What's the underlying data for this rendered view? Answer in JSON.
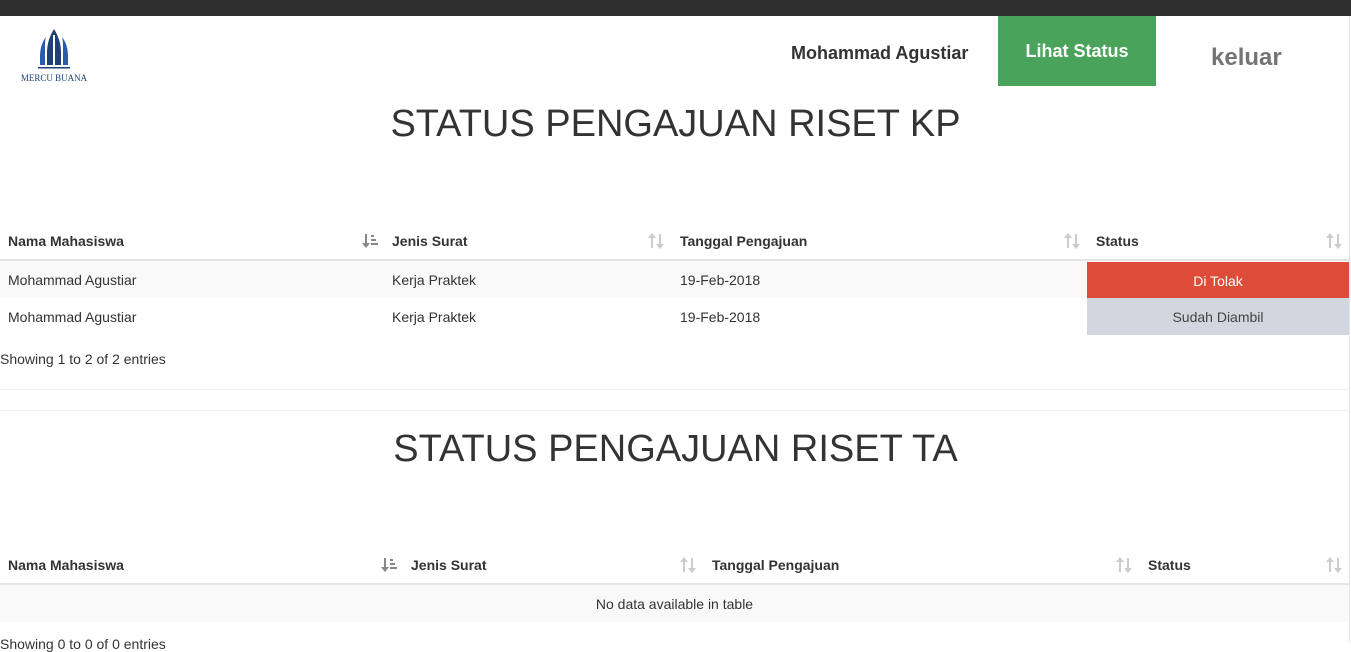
{
  "header": {
    "logo_text": "MERCU BUANA",
    "user_name": "Mohammad Agustiar",
    "status_button": "Lihat Status",
    "logout": "keluar",
    "accent_green": "#4aa35a"
  },
  "kp": {
    "title": "STATUS PENGAJUAN RISET KP",
    "columns": [
      "Nama Mahasiswa",
      "Jenis Surat",
      "Tanggal Pengajuan",
      "Status"
    ],
    "rows": [
      {
        "nama": "Mohammad Agustiar",
        "jenis": "Kerja Praktek",
        "tanggal": "19-Feb-2018",
        "status": "Di Tolak",
        "status_color": "#dd4b39"
      },
      {
        "nama": "Mohammad Agustiar",
        "jenis": "Kerja Praktek",
        "tanggal": "19-Feb-2018",
        "status": "Sudah Diambil",
        "status_color": "#d2d6de"
      }
    ],
    "info": "Showing 1 to 2 of 2 entries"
  },
  "ta": {
    "title": "STATUS PENGAJUAN RISET TA",
    "columns": [
      "Nama Mahasiswa",
      "Jenis Surat",
      "Tanggal Pengajuan",
      "Status"
    ],
    "empty": "No data available in table",
    "info": "Showing 0 to 0 of 0 entries"
  }
}
